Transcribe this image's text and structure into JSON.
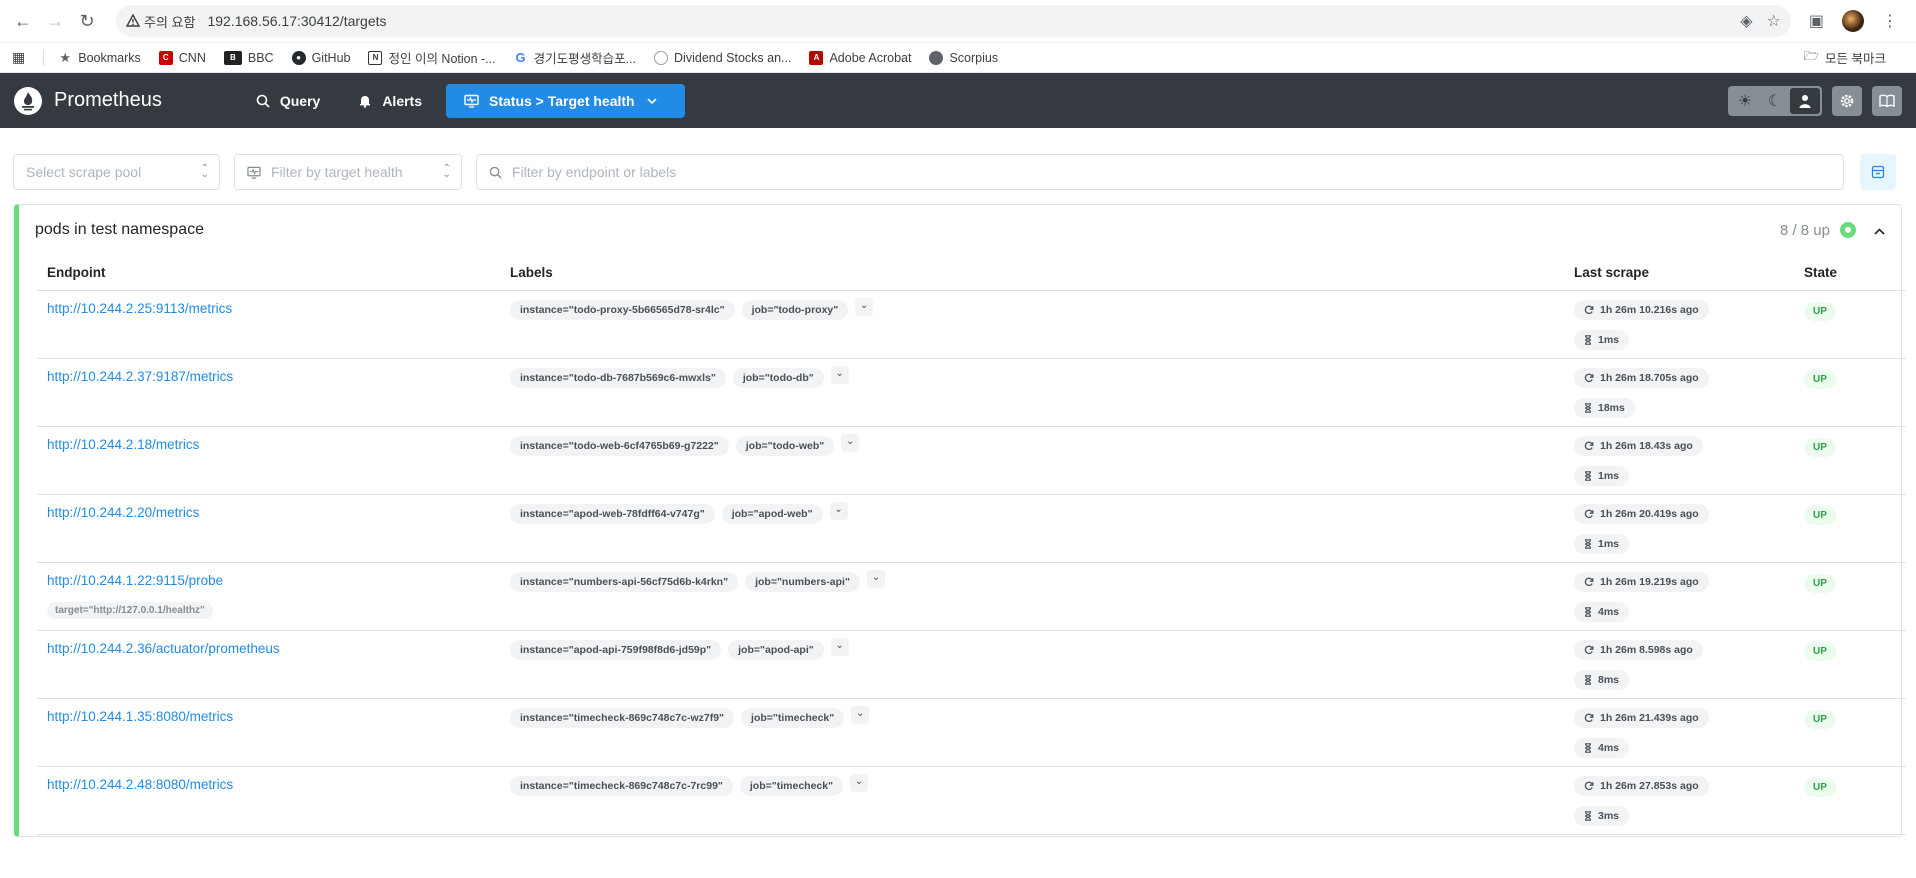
{
  "browser": {
    "warning": "주의 요함",
    "url": "192.168.56.17:30412/targets",
    "bookmarks": [
      {
        "label": "Bookmarks",
        "icon": "star-icon"
      },
      {
        "label": "CNN",
        "icon": "cnn-icon"
      },
      {
        "label": "BBC",
        "icon": "bbc-icon"
      },
      {
        "label": "GitHub",
        "icon": "github-icon"
      },
      {
        "label": "정인 이의 Notion -...",
        "icon": "notion-icon"
      },
      {
        "label": "경기도평생학습포...",
        "icon": "google-icon"
      },
      {
        "label": "Dividend Stocks an...",
        "icon": "globe-icon"
      },
      {
        "label": "Adobe Acrobat",
        "icon": "acrobat-icon"
      },
      {
        "label": "Scorpius",
        "icon": "globe-icon"
      }
    ],
    "all_bookmarks": "모든 북마크"
  },
  "header": {
    "app_name": "Prometheus",
    "nav_query": "Query",
    "nav_alerts": "Alerts",
    "nav_status": "Status > Target health"
  },
  "filters": {
    "scrape_pool_placeholder": "Select scrape pool",
    "health_placeholder": "Filter by target health",
    "endpoint_placeholder": "Filter by endpoint or labels"
  },
  "pool": {
    "title": "pods in test namespace",
    "status": "8 / 8 up",
    "columns": {
      "endpoint": "Endpoint",
      "labels": "Labels",
      "last_scrape": "Last scrape",
      "state": "State"
    },
    "targets": [
      {
        "endpoint": "http://10.244.2.25:9113/metrics",
        "instance": "instance=\"todo-proxy-5b66565d78-sr4lc\"",
        "job": "job=\"todo-proxy\"",
        "last_scrape": "1h 26m 10.216s ago",
        "duration": "1ms",
        "state": "UP"
      },
      {
        "endpoint": "http://10.244.2.37:9187/metrics",
        "instance": "instance=\"todo-db-7687b569c6-mwxls\"",
        "job": "job=\"todo-db\"",
        "last_scrape": "1h 26m 18.705s ago",
        "duration": "18ms",
        "state": "UP"
      },
      {
        "endpoint": "http://10.244.2.18/metrics",
        "instance": "instance=\"todo-web-6cf4765b69-g7222\"",
        "job": "job=\"todo-web\"",
        "last_scrape": "1h 26m 18.43s ago",
        "duration": "1ms",
        "state": "UP"
      },
      {
        "endpoint": "http://10.244.2.20/metrics",
        "instance": "instance=\"apod-web-78fdff64-v747g\"",
        "job": "job=\"apod-web\"",
        "last_scrape": "1h 26m 20.419s ago",
        "duration": "1ms",
        "state": "UP"
      },
      {
        "endpoint": "http://10.244.1.22:9115/probe",
        "endpoint_label": "target=\"http://127.0.0.1/healthz\"",
        "instance": "instance=\"numbers-api-56cf75d6b-k4rkn\"",
        "job": "job=\"numbers-api\"",
        "last_scrape": "1h 26m 19.219s ago",
        "duration": "4ms",
        "state": "UP"
      },
      {
        "endpoint": "http://10.244.2.36/actuator/prometheus",
        "instance": "instance=\"apod-api-759f98f8d6-jd59p\"",
        "job": "job=\"apod-api\"",
        "last_scrape": "1h 26m 8.598s ago",
        "duration": "8ms",
        "state": "UP"
      },
      {
        "endpoint": "http://10.244.1.35:8080/metrics",
        "instance": "instance=\"timecheck-869c748c7c-wz7f9\"",
        "job": "job=\"timecheck\"",
        "last_scrape": "1h 26m 21.439s ago",
        "duration": "4ms",
        "state": "UP"
      },
      {
        "endpoint": "http://10.244.2.48:8080/metrics",
        "instance": "instance=\"timecheck-869c748c7c-7rc99\"",
        "job": "job=\"timecheck\"",
        "last_scrape": "1h 26m 27.853s ago",
        "duration": "3ms",
        "state": "UP"
      }
    ]
  }
}
